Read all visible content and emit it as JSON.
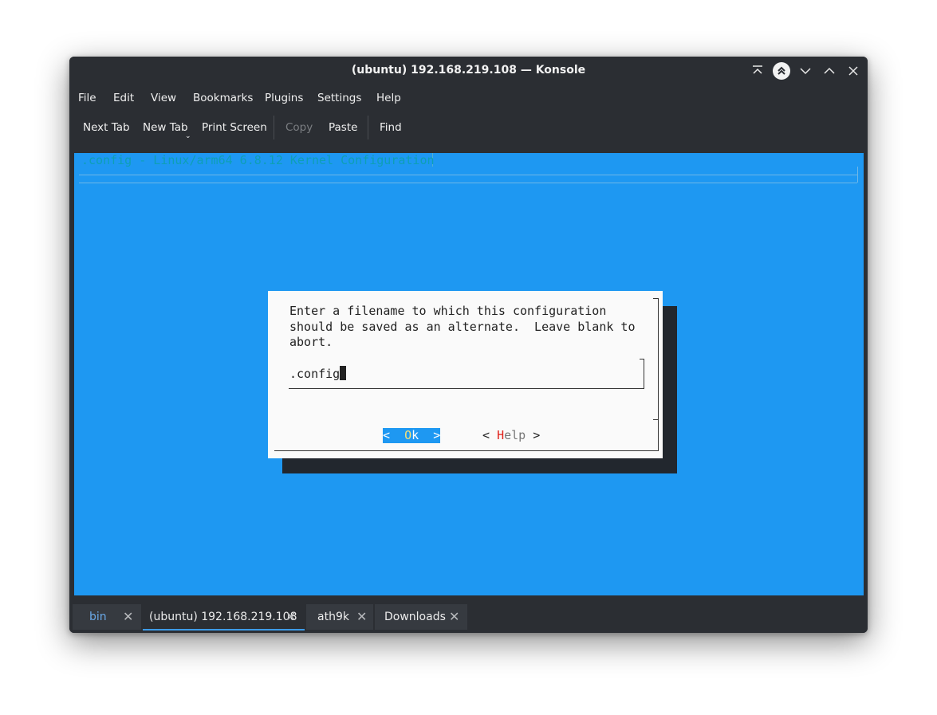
{
  "window": {
    "title": "(ubuntu) 192.168.219.108 — Konsole"
  },
  "menubar": {
    "items": [
      "File",
      "Edit",
      "View",
      "Bookmarks",
      "Plugins",
      "Settings",
      "Help"
    ]
  },
  "toolbar": {
    "next_tab": "Next Tab",
    "new_tab": "New Tab",
    "print_screen": "Print Screen",
    "copy": "Copy",
    "paste": "Paste",
    "find": "Find"
  },
  "terminal": {
    "header": ".config - Linux/arm64 6.8.12 Kernel Configuration",
    "dialog": {
      "message": "Enter a filename to which this configuration\nshould be saved as an alternate.  Leave blank to\nabort.",
      "input_value": ".config",
      "ok_prefix": "< ",
      "ok_hotkey": " O",
      "ok_rest": "k  >",
      "help_prefix": "< ",
      "help_hotkey": "H",
      "help_rest": "elp",
      "help_suffix": " >"
    }
  },
  "tabs": [
    {
      "label": "bin",
      "active": false
    },
    {
      "label": "(ubuntu) 192.168.219.108",
      "active": true
    },
    {
      "label": "ath9k",
      "active": false
    },
    {
      "label": "Downloads",
      "active": false
    }
  ],
  "colors": {
    "terminal_bg": "#1e98f2",
    "window_bg": "#2b2e33",
    "active_tab_accent": "#3d9be8"
  }
}
